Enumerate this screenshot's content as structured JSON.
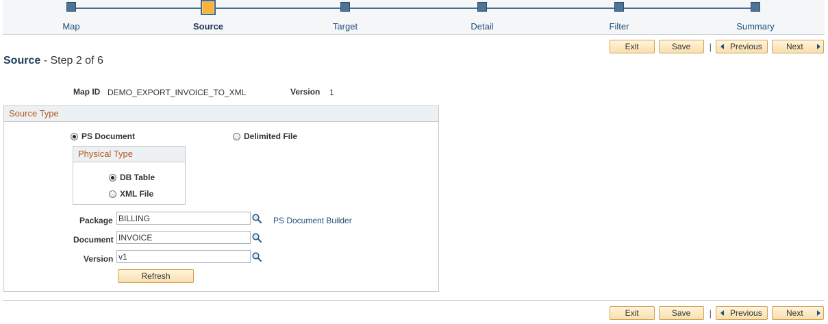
{
  "steps": [
    {
      "label": "Map"
    },
    {
      "label": "Source"
    },
    {
      "label": "Target"
    },
    {
      "label": "Detail"
    },
    {
      "label": "Filter"
    },
    {
      "label": "Summary"
    }
  ],
  "active_step": "Source",
  "buttons": {
    "exit": "Exit",
    "save": "Save",
    "previous": "Previous",
    "next": "Next",
    "separator": "|",
    "refresh": "Refresh"
  },
  "page": {
    "title": "Source",
    "subtitle": " - Step 2 of 6"
  },
  "header_info": {
    "map_id_label": "Map ID",
    "map_id_value": "DEMO_EXPORT_INVOICE_TO_XML",
    "version_label": "Version",
    "version_value": "1"
  },
  "source_type": {
    "title": "Source Type",
    "options": [
      {
        "label": "PS Document",
        "selected": true
      },
      {
        "label": "Delimited File",
        "selected": false
      }
    ]
  },
  "physical_type": {
    "title": "Physical Type",
    "options": [
      {
        "label": "DB Table",
        "selected": true
      },
      {
        "label": "XML File",
        "selected": false
      }
    ]
  },
  "fields": {
    "package_label": "Package",
    "package_value": "BILLING",
    "document_label": "Document",
    "document_value": "INVOICE",
    "version_label": "Version",
    "version_value": "v1"
  },
  "links": {
    "ps_document_builder": "PS Document Builder"
  },
  "colors": {
    "accent": "#1f4e7a",
    "group_title": "#b4551a",
    "active_step": "#f8b33b",
    "button_bg": "#f8dfae"
  }
}
